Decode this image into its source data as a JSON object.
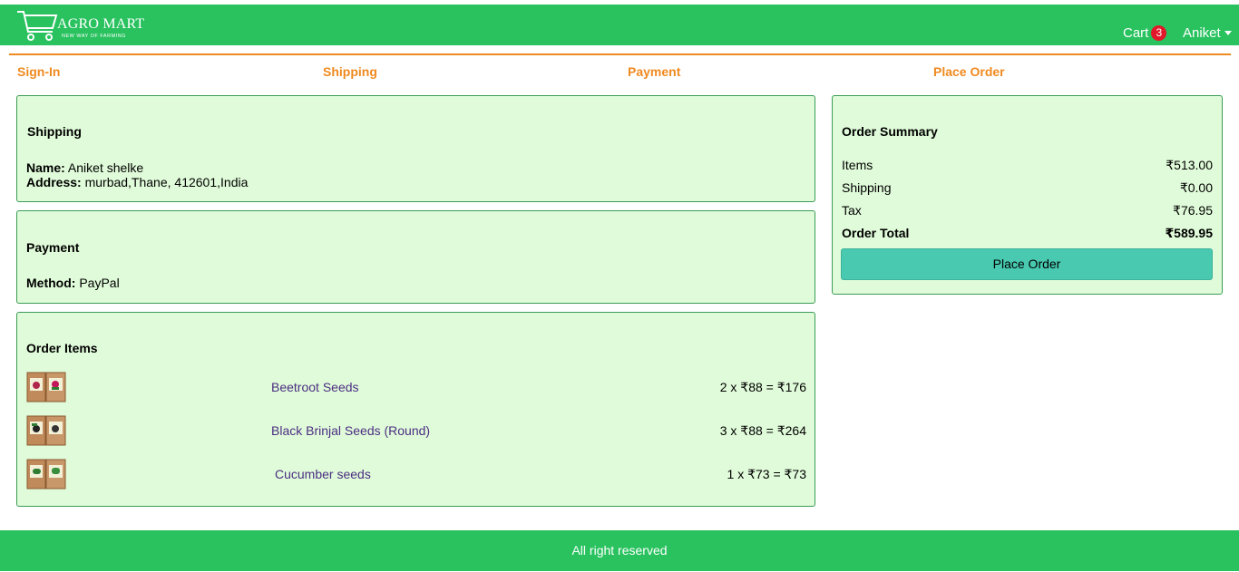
{
  "header": {
    "brand_title": "AGRO MART",
    "brand_subtitle": "NEW WAY OF FARMING",
    "cart_label": "Cart",
    "cart_count": "3",
    "user_name": "Aniket",
    "bg_color": "#29c25f"
  },
  "steps": [
    "Sign-In",
    "Shipping",
    "Payment",
    "Place Order"
  ],
  "shipping": {
    "title": "Shipping",
    "name_label": "Name:",
    "name_value": "Aniket shelke",
    "address_label": "Address:",
    "address_value": "murbad,Thane, 412601,India"
  },
  "payment": {
    "title": "Payment",
    "method_label": "Method:",
    "method_value": "PayPal"
  },
  "order_items": {
    "title": "Order Items",
    "items": [
      {
        "name": "Beetroot Seeds",
        "price": "2 x ₹88 = ₹176"
      },
      {
        "name": "Black Brinjal Seeds (Round)",
        "price": "3 x ₹88 = ₹264"
      },
      {
        "name": "Cucumber seeds",
        "price": "1 x ₹73 = ₹73"
      }
    ]
  },
  "summary": {
    "title": "Order Summary",
    "items_label": "Items",
    "items_value": "₹513.00",
    "shipping_label": "Shipping",
    "shipping_value": "₹0.00",
    "tax_label": "Tax",
    "tax_value": "₹76.95",
    "total_label": "Order Total",
    "total_value": "₹589.95",
    "button_label": "Place Order"
  },
  "footer": {
    "text": "All right reserved"
  },
  "colors": {
    "accent": "#f08a20",
    "card_bg": "#e0fbd9",
    "button": "#48c9b0",
    "badge": "#e2182a"
  }
}
